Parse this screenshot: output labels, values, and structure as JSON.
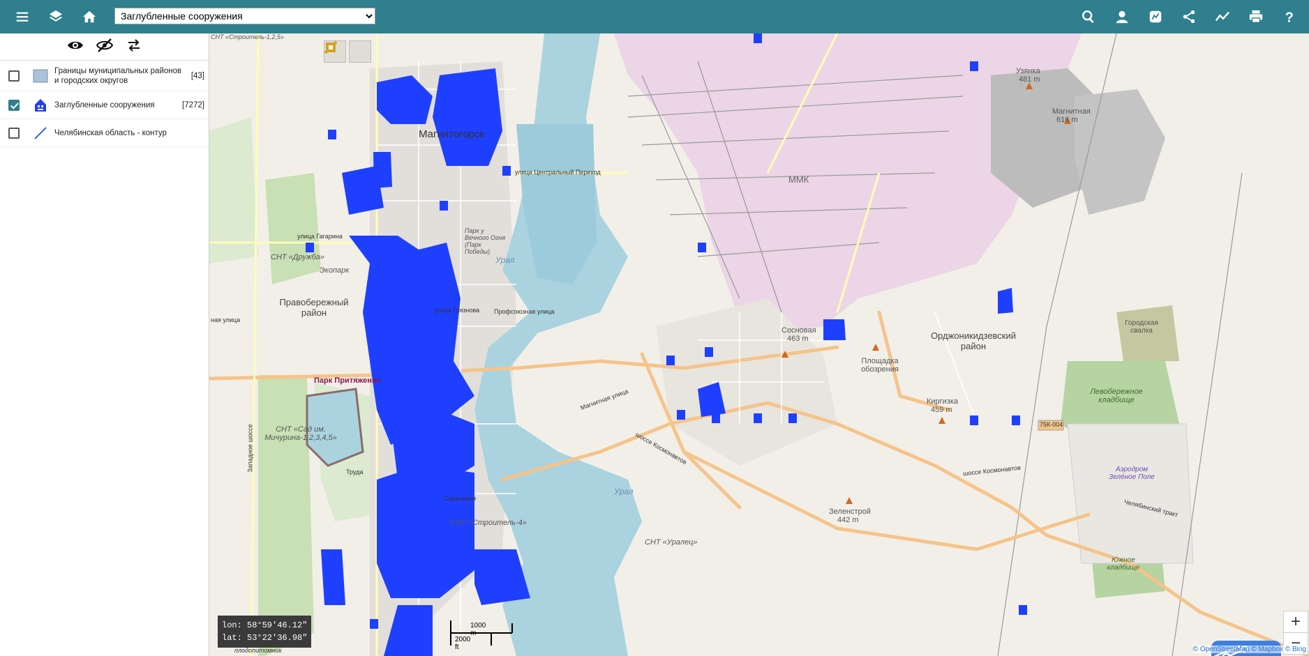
{
  "toolbar": {
    "layer_select_value": "Заглубленные сооружения",
    "layer_select_options": [
      "Заглубленные сооружения"
    ]
  },
  "layers": [
    {
      "name": "Границы муниципальных районов и городских округов",
      "count": "[43]",
      "checked": false,
      "legend": "polygon"
    },
    {
      "name": "Заглубленные сооружения",
      "count": "[7272]",
      "checked": true,
      "legend": "building-marker"
    },
    {
      "name": "Челябинская область - контур",
      "count": "",
      "checked": false,
      "legend": "line"
    }
  ],
  "map_labels": {
    "city": "Магнитогорск",
    "district_right": "Правобережный район",
    "district_ord": "Орджоникидзевский район",
    "snt_druzhba": "СНТ «Дружба»",
    "snt_sad": "СНТ «Сад им. Мичурина-1,2,3,4,5»",
    "snt_stroitel4": "СНТ «Строитель-4»",
    "snt_uralets": "СНТ «Уралец»",
    "snt_stroitel125": "СНТ «Строитель-1,2,5»",
    "ekopark": "Экопарк",
    "park_prityazhenie": "Парк Притяжение",
    "park_victory": "Парк у Вечного Огня (Парк Победы)",
    "ural_1": "Урал",
    "ural_2": "Урал",
    "mmk": "ММК",
    "uzyanka": "Узянка",
    "uzyanka_h": "481 m",
    "magnitnaya": "Магнитная",
    "magnitnaya_h": "616 m",
    "sosnovaya": "Сосновая",
    "sosnovaya_h": "463 m",
    "kirgizka": "Киргизка",
    "kirgizka_h": "459 m",
    "zelenstroy": "Зеленстрой",
    "zelenstroy_h": "442 m",
    "ploshchadka": "Площадка обозрения",
    "gor_svalka": "Городская свалка",
    "cemetery_left": "Левобережное кладбище",
    "cemetery_south": "Южное кладбище",
    "airport": "Аэродром Зелёное Поле",
    "road_75k": "75К-004",
    "st_central": "улица Центральный Переход",
    "st_gryaznova": "улица Грязнова",
    "st_profsoyuz": "Профсоюзная улица",
    "st_gagarina": "улица Гагарина",
    "st_magnitnaya": "Магнитная улица",
    "st_kosmonavtov": "шоссе Космонавтов",
    "st_kosmonavtov2": "шоссе Космонавтов",
    "st_chelyab": "Челябинский тракт",
    "st_zapadnoe": "Западное шоссе",
    "st_trud": "Труда",
    "st_sirenevaya": "Сиреневая",
    "st_nay": "ная улица",
    "st_plodopitomnik": "плодопитомник"
  },
  "coords": {
    "lon": "lon: 58°59′46.12″",
    "lat": "lat: 53°22′36.98″"
  },
  "scale": {
    "metric": "1000 m",
    "imperial": "2000 ft"
  },
  "zoom": {
    "in": "+",
    "out": "−"
  },
  "attribution": {
    "osm": "© OpenStreetMap",
    "mapbox": "© Mapbox",
    "bing": "© Bing"
  },
  "colors": {
    "header": "#2f7f8e",
    "water": "#aad3df",
    "marker": "#1f3fff",
    "park": "#c8e0b4",
    "industrial": "#ecd5e6"
  }
}
